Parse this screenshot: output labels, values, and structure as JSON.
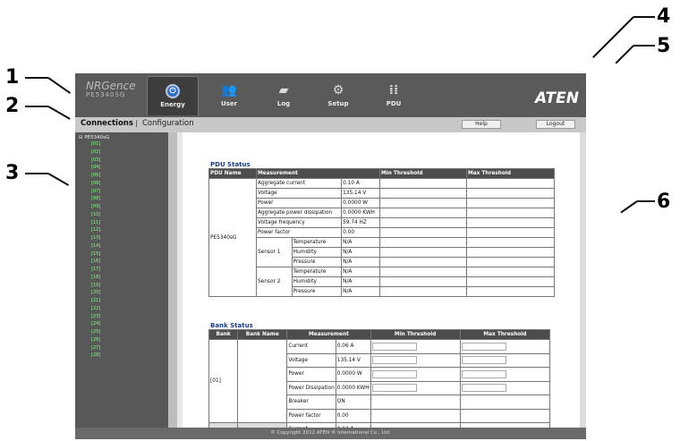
{
  "callouts": [
    "1",
    "2",
    "3",
    "4",
    "5",
    "6"
  ],
  "app": {
    "logo_line1": "NRGence",
    "logo_line2": "PE5340SG",
    "brand": "ATEN",
    "tabs": [
      "Energy",
      "User",
      "Log",
      "Setup",
      "PDU"
    ],
    "nav_connections": "Connections",
    "nav_separator": "|",
    "nav_configuration": "Configuration",
    "help": "Help",
    "logout": "Logout",
    "device": "PE5340sG",
    "outlets": [
      "[01]",
      "[02]",
      "[03]",
      "[04]",
      "[05]",
      "[06]",
      "[07]",
      "[08]",
      "[09]",
      "[10]",
      "[11]",
      "[12]",
      "[13]",
      "[14]",
      "[15]",
      "[16]",
      "[17]",
      "[18]",
      "[19]",
      "[20]",
      "[21]",
      "[22]",
      "[23]",
      "[24]",
      "[25]",
      "[26]",
      "[27]",
      "[28]"
    ],
    "footer": "© Copyright 2012 ATEN ® International Co., Ltd."
  },
  "pdu_status": {
    "title": "PDU Status",
    "headers": [
      "PDU Name",
      "Measurement",
      "Min Threshold",
      "Max Threshold"
    ],
    "name": "PE5340sG",
    "rows": [
      {
        "label": "Aggregate current",
        "value": "0.10 A"
      },
      {
        "label": "Voltage",
        "value": "135.14 V"
      },
      {
        "label": "Power",
        "value": "0.0000 W"
      },
      {
        "label": "Aggregate power dissipation",
        "value": "0.0000 KWH"
      },
      {
        "label": "Voltage frequency",
        "value": "59.74 HZ"
      },
      {
        "label": "Power factor",
        "value": "0.00"
      }
    ],
    "sensors": [
      {
        "name": "Sensor 1",
        "rows": [
          {
            "label": "Temperature",
            "value": "N/A"
          },
          {
            "label": "Humidity",
            "value": "N/A"
          },
          {
            "label": "Pressure",
            "value": "N/A"
          }
        ]
      },
      {
        "name": "Sensor 2",
        "rows": [
          {
            "label": "Temperature",
            "value": "N/A"
          },
          {
            "label": "Humidity",
            "value": "N/A"
          },
          {
            "label": "Pressure",
            "value": "N/A"
          }
        ]
      }
    ]
  },
  "bank_status": {
    "title": "Bank Status",
    "headers": [
      "Bank",
      "Bank Name",
      "Measurement",
      "Min Threshold",
      "Max Threshold"
    ],
    "bank": "[01]",
    "rows": [
      {
        "label": "Current",
        "value": "0.06 A"
      },
      {
        "label": "Voltage",
        "value": "135.14 V"
      },
      {
        "label": "Power",
        "value": "0.0000 W"
      },
      {
        "label": "Power Dissipation",
        "value": "0.0000 KWH"
      },
      {
        "label": "Breaker",
        "value": "ON"
      },
      {
        "label": "Power factor",
        "value": "0.00"
      }
    ],
    "next_label": "Current",
    "next_value": "0.04 A"
  }
}
